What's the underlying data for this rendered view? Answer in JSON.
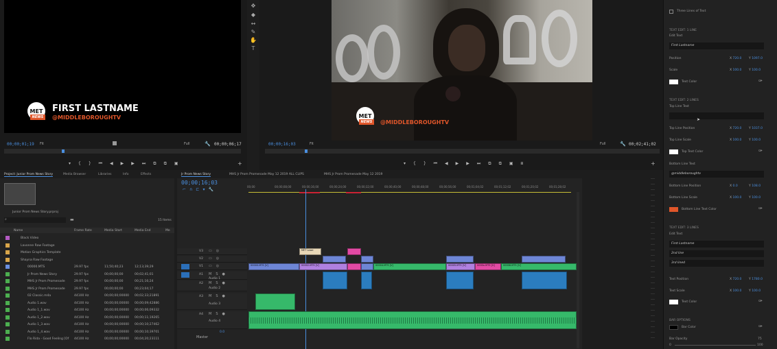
{
  "source_monitor": {
    "title_text": "FIRST LASTNAME",
    "handle_text": "@MIDDLEBOROUGHTV",
    "logo_top": "MET",
    "logo_bottom": "NEWS",
    "timecode_left": "00;00;01;19",
    "fit_label": "Fit",
    "quality_label": "Full",
    "timecode_right": "00;00;06;17"
  },
  "program_monitor": {
    "handle_text": "@MIDDLEBOROUGHTV",
    "logo_top": "MET",
    "logo_bottom": "NEWS",
    "timecode_left": "00;00;16;03",
    "fit_label": "Fit",
    "quality_label": "Full",
    "timecode_right": "00;02;41;02"
  },
  "essential_graphics": {
    "top_items": [
      "Three Lines of Text"
    ],
    "section1_title": "TEXT EDIT: 1 LINE",
    "edit_text_label": "Edit Text",
    "line1_value": "First Lastname",
    "position_label": "Position",
    "pos1_x": "720.0",
    "pos1_y": "1097.0",
    "scale_label": "Scale",
    "scale1_x": "100.0",
    "scale1_y": "100.0",
    "text_color_label": "Text Color",
    "section2_title": "TEXT EDIT: 2 LINES",
    "top_line_text_label": "Top Line Text",
    "top_line_pos_label": "Top Line Position",
    "pos2_x": "720.0",
    "pos2_y": "1037.0",
    "top_line_scale_label": "Top Line Scale",
    "scale2_x": "100.0",
    "scale2_y": "100.0",
    "top_text_color_label": "Top Text Color",
    "bottom_line_text_label": "Bottom Line Text",
    "bottom_line_value": "@middleboroughtv",
    "bottom_line_pos_label": "Bottom Line Position",
    "pos3_x": "0.0",
    "pos3_y": "108.0",
    "bottom_line_scale_label": "Bottom Line Scale",
    "scale3_x": "100.0",
    "scale3_y": "100.0",
    "bottom_text_color_label": "Bottom Line Text Color",
    "section3_title": "TEXT EDIT: 3 LINES",
    "edit_text_label2": "Edit Text",
    "three_line_values": [
      "First Lastname",
      "2nd line",
      "3rd lined"
    ],
    "text_position_label": "Text Position",
    "pos4_x": "720.0",
    "pos4_y": "1780.0",
    "text_scale_label": "Text Scale",
    "scale4_x": "100.0",
    "scale4_y": "100.0",
    "text_color_label2": "Text Color",
    "bar_options_title": "BAR OPTIONS",
    "bar_color_label": "Bar Color",
    "bar_opacity_label": "Bar Opacity",
    "bar_opacity_value": "75",
    "bar_opacity_min": "0",
    "bar_opacity_max": "100",
    "x_label": "X",
    "y_label": "Y",
    "colors": {
      "white": "#ffffff",
      "orange": "#e0562a",
      "black": "#000000"
    }
  },
  "project": {
    "tabs": [
      "Project: Junior Prom News Story",
      "Media Browser",
      "Libraries",
      "Info",
      "Effects"
    ],
    "project_file": "Junior Prom News Story.prproj",
    "items_count": "15 Items",
    "columns": [
      "Name",
      "Frame Rate",
      "Media Start",
      "Media End",
      "Me"
    ],
    "rows": [
      {
        "name": "Black Video",
        "fps": "",
        "start": "",
        "end": "",
        "color": "#b45ac4",
        "indent": 1
      },
      {
        "name": "Lavonne Raw Footage",
        "fps": "",
        "start": "",
        "end": "",
        "color": "#d9a64a",
        "indent": 1
      },
      {
        "name": "Motion Graphics Template",
        "fps": "",
        "start": "",
        "end": "",
        "color": "#d9a64a",
        "indent": 1
      },
      {
        "name": "Shayna Raw Footage",
        "fps": "",
        "start": "",
        "end": "",
        "color": "#d9a64a",
        "indent": 1
      },
      {
        "name": "00000.MTS",
        "fps": "29.97 fps",
        "start": "11;50;40;23",
        "end": "12;13;39;29",
        "color": "#6a8fe0",
        "indent": 2
      },
      {
        "name": "Jr Prom News Story",
        "fps": "29.97 fps",
        "start": "00;00;00;00",
        "end": "00;02;41;01",
        "color": "#4caf50",
        "indent": 2
      },
      {
        "name": "MHS Jr Prom Promenade",
        "fps": "29.97 fps",
        "start": "00;00;00;00",
        "end": "00;21;16;24",
        "color": "#4caf50",
        "indent": 2
      },
      {
        "name": "MHS Jr Prom Promenade",
        "fps": "29.97 fps",
        "start": "00;00;00;00",
        "end": "00;23;04;17",
        "color": "#4caf50",
        "indent": 2
      },
      {
        "name": "02 Classic.m4a",
        "fps": "44100 Hz",
        "start": "00;00;00;00000",
        "end": "00;02;33;21891",
        "color": "#4caf50",
        "indent": 2
      },
      {
        "name": "Audio 1.wav",
        "fps": "44100 Hz",
        "start": "00;00;00;00000",
        "end": "00;00;09;42886",
        "color": "#4caf50",
        "indent": 2
      },
      {
        "name": "Audio 1_1.wav",
        "fps": "44100 Hz",
        "start": "00;00;00;00000",
        "end": "00;00;06;09332",
        "color": "#4caf50",
        "indent": 2
      },
      {
        "name": "Audio 1_2.wav",
        "fps": "44100 Hz",
        "start": "00;00;00;00000",
        "end": "00;00;11;19265",
        "color": "#4caf50",
        "indent": 2
      },
      {
        "name": "Audio 1_3.wav",
        "fps": "44100 Hz",
        "start": "00;00;00;00000",
        "end": "00;00;10;27462",
        "color": "#4caf50",
        "indent": 2
      },
      {
        "name": "Audio 1_4.wav",
        "fps": "44100 Hz",
        "start": "00;00;00;00000",
        "end": "00;00;10;39701",
        "color": "#4caf50",
        "indent": 2
      },
      {
        "name": "Flo Rida - Good Feeling [Of",
        "fps": "44100 Hz",
        "start": "00;00;00;00000",
        "end": "00;04;20;23111",
        "color": "#4caf50",
        "indent": 2
      }
    ]
  },
  "timeline": {
    "tabs": [
      "Jr Prom News Story",
      "MHS Jr Prom Promenade May 12 2019 ALL CLIPS",
      "MHS Jr Prom Promenade May 12 2019"
    ],
    "timecode": "00;00;16;03",
    "ruler": [
      "00;00",
      "00;00;08;00",
      "00;00;16;00",
      "00;00;24;00",
      "00;00;32;00",
      "00;00;40;00",
      "00;00;48;00",
      "00;00;56;00",
      "00;01;04;02",
      "00;01;12;02",
      "00;01;20;02",
      "00;01;28;02"
    ],
    "tracks": [
      "V3",
      "V2",
      "V1",
      "A1",
      "A2",
      "A3",
      "A4"
    ],
    "track_names": {
      "a1": "Audio 1",
      "a2": "Audio 2",
      "a3": "Audio 3",
      "a4": "Audio 4"
    },
    "master_label": "Master",
    "master_value": "0.0",
    "v3_clip": "MET Lowe",
    "v1_clips": [
      "00000.MTS [V]",
      "00002.MTS [V]",
      "00003.MTS [V]",
      "00004.MTS [V]",
      "00005.MTS [V]",
      "0000x.MTS [V]",
      "00006.MTS [V]"
    ]
  }
}
